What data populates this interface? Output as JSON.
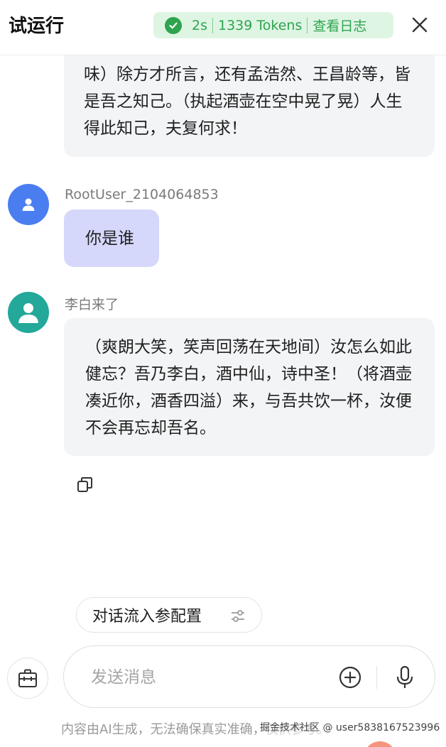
{
  "header": {
    "title": "试运行",
    "run_time": "2s",
    "tokens": "1339 Tokens",
    "log_link": "查看日志",
    "status_color": "#2ea44f"
  },
  "messages": {
    "top_bot_text": "味）除方才所言，还有孟浩然、王昌龄等，皆是吾之知己。（执起酒壶在空中晃了晃）人生得此知己，夫复何求！",
    "user_name": "RootUser_2104064853",
    "user_text": "你是谁",
    "bot_name": "李白来了",
    "bot_text": "（爽朗大笑，笑声回荡在天地间）汝怎么如此健忘？吾乃李白，酒中仙，诗中圣！（将酒壶凑近你，酒香四溢）来，与吾共饮一杯，汝便不会再忘却吾名。"
  },
  "controls": {
    "config_label": "对话流入参配置",
    "input_placeholder": "发送消息",
    "disclaimer": "内容由AI生成，无法确保真实准确，仅供参考。",
    "watermark": "掘金技术社区 @ user5838167523996"
  },
  "icons": {
    "status": "check-circle-icon",
    "close": "close-icon",
    "user_avatar": "user-icon",
    "bot_avatar": "user-icon",
    "copy": "copy-icon",
    "config": "sliders-icon",
    "toolbox": "toolbox-icon",
    "add": "plus-circle-icon",
    "voice": "microphone-icon"
  },
  "colors": {
    "user_bubble": "#d5d8fb",
    "bot_bubble": "#f3f4f6",
    "user_avatar": "#4a7df0",
    "bot_avatar": "#23a89a"
  }
}
